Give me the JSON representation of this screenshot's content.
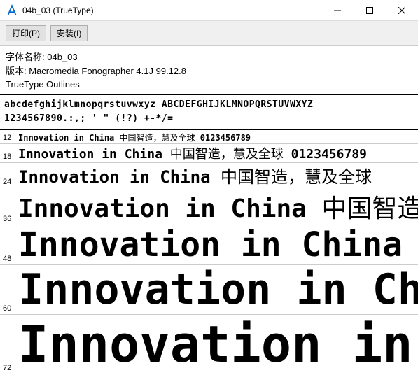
{
  "window": {
    "title": "04b_03 (TrueType)"
  },
  "toolbar": {
    "print": "打印(P)",
    "install": "安装(I)"
  },
  "info": {
    "name_label": "字体名称: ",
    "name_value": "04b_03",
    "version_label": "版本: ",
    "version_value": "Macromedia Fonographer 4.1J 99.12.8",
    "outlines": "TrueType Outlines"
  },
  "glyphs": {
    "row1": "abcdefghijklmnopqrstuvwxyz ABCDEFGHIJKLMNOPQRSTUVWXYZ",
    "row2": "1234567890.:,; ' \" (!?) +-*/="
  },
  "sample": {
    "latin": "Innovation in China",
    "cjk": "中国智造，慧及全球",
    "digits": "0123456789"
  },
  "sizes": [
    "12",
    "18",
    "24",
    "36",
    "48",
    "60",
    "72"
  ]
}
